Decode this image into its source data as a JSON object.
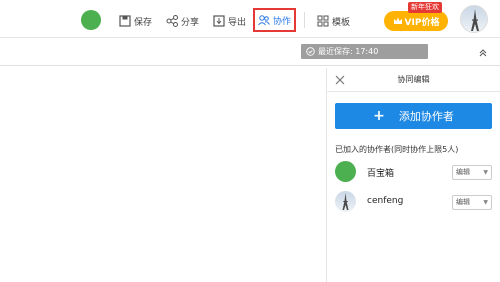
{
  "toolbar": {
    "save_label": "保存",
    "share_label": "分享",
    "export_label": "导出",
    "collab_label": "协作",
    "template_label": "模板",
    "vip_label": "VIP价格",
    "vip_badge": "新年狂欢"
  },
  "savebar": {
    "status": "最近保存: 17:40"
  },
  "panel": {
    "title": "协同编辑",
    "add_button": "添加协作者",
    "limit_text": "已加入的协作者(同时协作上限5人)",
    "members": [
      {
        "name": "百宝箱",
        "role": "编辑",
        "avatar_color": "#4caf50"
      },
      {
        "name": "cenfeng",
        "role": "编辑",
        "avatar_color": "#cfd8e3"
      }
    ]
  },
  "colors": {
    "accent": "#2b78e4",
    "vip": "#ffb300",
    "highlight_border": "#e53935"
  }
}
